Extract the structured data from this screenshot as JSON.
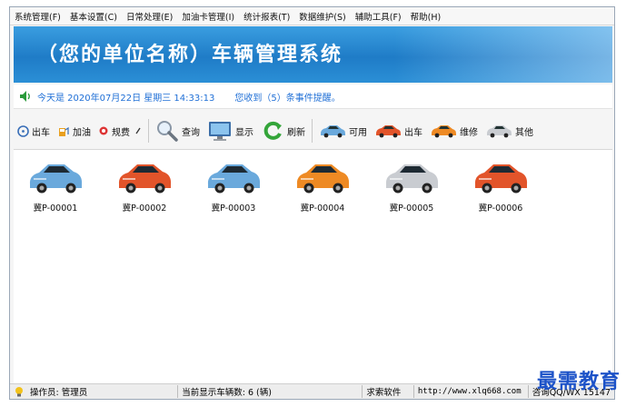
{
  "menu": [
    "系统管理(F)",
    "基本设置(C)",
    "日常处理(E)",
    "加油卡管理(I)",
    "统计报表(T)",
    "数据维护(S)",
    "辅助工具(F)",
    "帮助(H)"
  ],
  "banner": {
    "title": "（您的单位名称）车辆管理系统"
  },
  "info": {
    "date_text": "今天是 2020年07月22日 星期三 14:33:13",
    "events_text": "您收到（5）条事件提醒。"
  },
  "toolbar": {
    "depart": "出车",
    "refuel": "加油",
    "violation": "规费",
    "query": "查询",
    "display": "显示",
    "refresh": "刷新",
    "filter_available": "可用",
    "filter_out": "出车",
    "filter_repair": "维修",
    "filter_other": "其他"
  },
  "vehicles": [
    {
      "plate": "冀P-00001",
      "color": "#6aa9dc"
    },
    {
      "plate": "冀P-00002",
      "color": "#e2542a"
    },
    {
      "plate": "冀P-00003",
      "color": "#6aa9dc"
    },
    {
      "plate": "冀P-00004",
      "color": "#ee8a24"
    },
    {
      "plate": "冀P-00005",
      "color": "#c9ccd1"
    },
    {
      "plate": "冀P-00006",
      "color": "#e2542a"
    }
  ],
  "status": {
    "operator": "操作员: 管理员",
    "count": "当前显示车辆数: 6 (辆)",
    "vendor": "求索软件",
    "url": "http://www.xlq668.com",
    "contact": "咨询QQ/WX 15147"
  },
  "watermark": "最需教育",
  "colors": {
    "banner": "#1f7cc7",
    "info_text": "#1f6fd6",
    "car_blue": "#6aa9dc",
    "car_red": "#e2542a",
    "car_orange": "#ee8a24",
    "car_silver": "#c9ccd1"
  }
}
